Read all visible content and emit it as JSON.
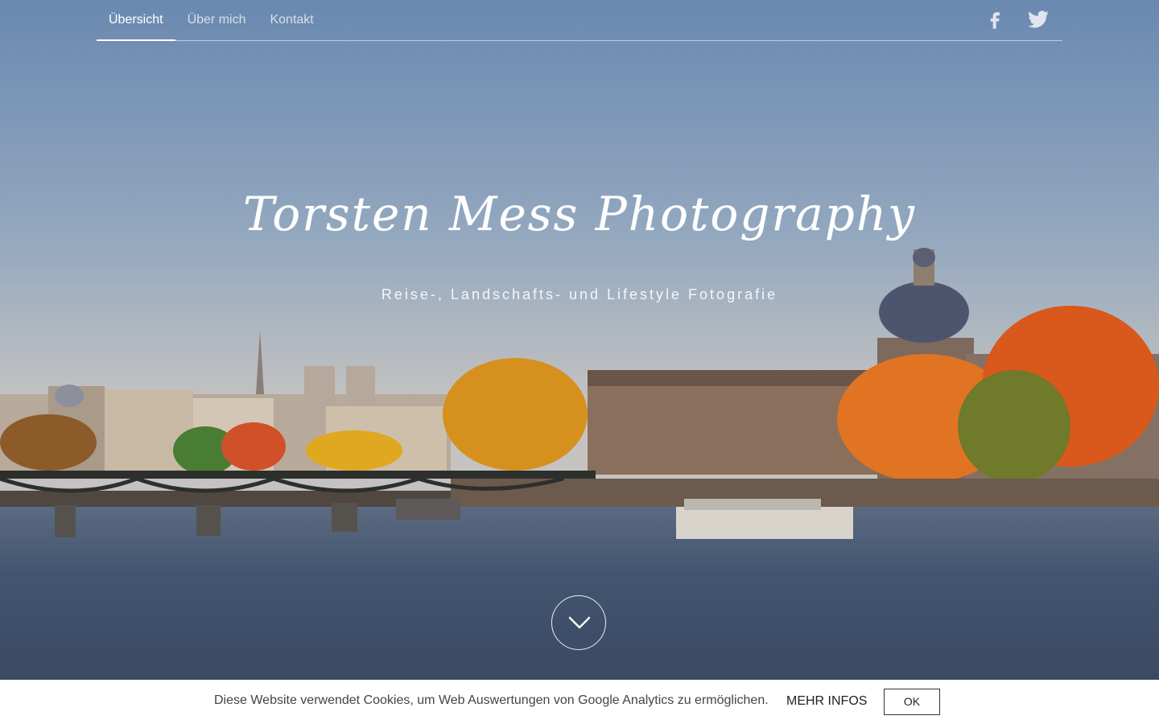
{
  "nav": {
    "items": [
      {
        "label": "Übersicht",
        "active": true
      },
      {
        "label": "Über mich",
        "active": false
      },
      {
        "label": "Kontakt",
        "active": false
      }
    ],
    "social": [
      "facebook-icon",
      "twitter-icon"
    ]
  },
  "hero": {
    "title": "Torsten Mess Photography",
    "subtitle": "Reise-, Landschafts- und Lifestyle Fotografie",
    "scroll_icon": "chevron-down-icon"
  },
  "cookie": {
    "text": "Diese Website verwendet Cookies, um Web Auswertungen von Google Analytics zu ermöglichen.",
    "more_label": "MEHR INFOS",
    "ok_label": "OK"
  },
  "colors": {
    "sky_top": "#6f8db2",
    "sky_bottom": "#c4c2c0",
    "water": "#3a4f6d",
    "foliage": "#d9741e"
  }
}
